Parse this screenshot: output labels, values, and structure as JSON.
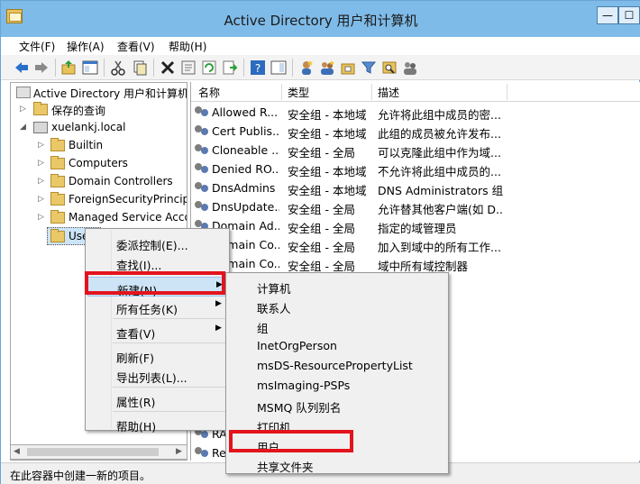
{
  "window": {
    "title": "Active Directory 用户和计算机"
  },
  "titlebar_buttons": {
    "minimize": "—",
    "maximize": "☐"
  },
  "menubar": [
    "文件(F)",
    "操作(A)",
    "查看(V)",
    "帮助(H)"
  ],
  "tree": [
    {
      "label": "Active Directory 用户和计算机",
      "level": 0,
      "arrow": "",
      "icon": "ad-icon"
    },
    {
      "label": "保存的查询",
      "level": 1,
      "arrow": "▷",
      "icon": "folder-icon"
    },
    {
      "label": "xuelankj.local",
      "level": 1,
      "arrow": "◢",
      "icon": "domain-icon"
    },
    {
      "label": "Builtin",
      "level": 2,
      "arrow": "▷",
      "icon": "folder-icon"
    },
    {
      "label": "Computers",
      "level": 2,
      "arrow": "▷",
      "icon": "folder-icon"
    },
    {
      "label": "Domain Controllers",
      "level": 2,
      "arrow": "▷",
      "icon": "folder-icon"
    },
    {
      "label": "ForeignSecurityPrincipals",
      "level": 2,
      "arrow": "▷",
      "icon": "folder-icon"
    },
    {
      "label": "Managed Service Accounts",
      "level": 2,
      "arrow": "▷",
      "icon": "folder-icon"
    },
    {
      "label": "Users",
      "level": 2,
      "arrow": "",
      "icon": "folder-icon"
    }
  ],
  "list": {
    "columns": [
      "名称",
      "类型",
      "描述"
    ],
    "rows": [
      [
        "Allowed R...",
        "安全组 - 本地域",
        "允许将此组中成员的密..."
      ],
      [
        "Cert Publis...",
        "安全组 - 本地域",
        "此组的成员被允许发布..."
      ],
      [
        "Cloneable ...",
        "安全组 - 全局",
        "可以克隆此组中作为域..."
      ],
      [
        "Denied RO...",
        "安全组 - 本地域",
        "不允许将此组中成员的..."
      ],
      [
        "DnsAdmins",
        "安全组 - 本地域",
        "DNS Administrators 组"
      ],
      [
        "DnsUpdate...",
        "安全组 - 全局",
        "允许替其他客户端(如 D..."
      ],
      [
        "Domain Ad...",
        "安全组 - 全局",
        "指定的域管理员"
      ],
      [
        "Domain Co...",
        "安全组 - 全局",
        "加入到域中的所有工作..."
      ],
      [
        "Domain Co...",
        "安全组 - 全局",
        "域中所有域控制器"
      ],
      [
        "",
        "",
        ""
      ],
      [
        "",
        "",
        "管理员"
      ],
      [
        "",
        "",
        "企业中的..."
      ],
      [
        "",
        "",
        "可以修..."
      ],
      [
        "",
        "",
        "机或访..."
      ],
      [
        "",
        "",
        "的内置帐..."
      ],
      [
        "",
        "",
        "到针对..."
      ],
      [
        "",
        "",
        "器可以..."
      ],
      [
        "RA...",
        "",
        "的..."
      ],
      [
        "Re...",
        "",
        "域中只..."
      ]
    ]
  },
  "context_menu": {
    "items": [
      {
        "label": "委派控制(E)...",
        "submenu": false
      },
      {
        "label": "查找(I)...",
        "submenu": false
      },
      {
        "sep": true
      },
      {
        "label": "新建(N)",
        "submenu": true,
        "highlighted": true
      },
      {
        "label": "所有任务(K)",
        "submenu": true
      },
      {
        "sep": true
      },
      {
        "label": "查看(V)",
        "submenu": true
      },
      {
        "sep": true
      },
      {
        "label": "刷新(F)",
        "submenu": false
      },
      {
        "label": "导出列表(L)...",
        "submenu": false
      },
      {
        "sep": true
      },
      {
        "label": "属性(R)",
        "submenu": false
      },
      {
        "sep": true
      },
      {
        "label": "帮助(H)",
        "submenu": false
      }
    ]
  },
  "new_submenu": {
    "items": [
      "计算机",
      "联系人",
      "组",
      "InetOrgPerson",
      "msDS-ResourcePropertyList",
      "msImaging-PSPs",
      "MSMQ 队列别名",
      "打印机",
      "用户",
      "共享文件夹"
    ]
  },
  "status": "在此容器中创建一新的项目。",
  "colors": {
    "titlebar": "#7fbbe8",
    "highlight_box": "#e3141d",
    "menu_hover": "#cde4f7"
  }
}
